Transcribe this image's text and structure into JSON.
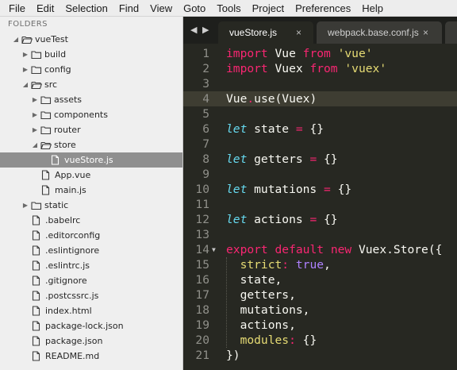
{
  "menu": [
    "File",
    "Edit",
    "Selection",
    "Find",
    "View",
    "Goto",
    "Tools",
    "Project",
    "Preferences",
    "Help"
  ],
  "sidebar": {
    "header": "FOLDERS",
    "tree": [
      {
        "label": "vueTest",
        "type": "folder",
        "open": true,
        "depth": 0
      },
      {
        "label": "build",
        "type": "folder",
        "open": false,
        "depth": 1
      },
      {
        "label": "config",
        "type": "folder",
        "open": false,
        "depth": 1
      },
      {
        "label": "src",
        "type": "folder",
        "open": true,
        "depth": 1
      },
      {
        "label": "assets",
        "type": "folder",
        "open": false,
        "depth": 2
      },
      {
        "label": "components",
        "type": "folder",
        "open": false,
        "depth": 2
      },
      {
        "label": "router",
        "type": "folder",
        "open": false,
        "depth": 2
      },
      {
        "label": "store",
        "type": "folder",
        "open": true,
        "depth": 2
      },
      {
        "label": "vueStore.js",
        "type": "file",
        "depth": 3,
        "selected": true
      },
      {
        "label": "App.vue",
        "type": "file",
        "depth": 2
      },
      {
        "label": "main.js",
        "type": "file",
        "depth": 2
      },
      {
        "label": "static",
        "type": "folder",
        "open": false,
        "depth": 1
      },
      {
        "label": ".babelrc",
        "type": "file",
        "depth": 1
      },
      {
        "label": ".editorconfig",
        "type": "file",
        "depth": 1
      },
      {
        "label": ".eslintignore",
        "type": "file",
        "depth": 1
      },
      {
        "label": ".eslintrc.js",
        "type": "file",
        "depth": 1
      },
      {
        "label": ".gitignore",
        "type": "file",
        "depth": 1
      },
      {
        "label": ".postcssrc.js",
        "type": "file",
        "depth": 1
      },
      {
        "label": "index.html",
        "type": "file",
        "depth": 1
      },
      {
        "label": "package-lock.json",
        "type": "file",
        "depth": 1
      },
      {
        "label": "package.json",
        "type": "file",
        "depth": 1
      },
      {
        "label": "README.md",
        "type": "file",
        "depth": 1
      }
    ]
  },
  "tabs": [
    {
      "label": "vueStore.js",
      "active": true,
      "close": "×"
    },
    {
      "label": "webpack.base.conf.js",
      "active": false,
      "close": "×"
    }
  ],
  "editor": {
    "current_line": 4,
    "folded_line": 14,
    "lines": [
      {
        "n": "1",
        "tokens": [
          [
            "keyword",
            "import"
          ],
          [
            "plain",
            " Vue "
          ],
          [
            "keyword",
            "from"
          ],
          [
            "plain",
            " "
          ],
          [
            "string",
            "'vue'"
          ]
        ]
      },
      {
        "n": "2",
        "tokens": [
          [
            "keyword",
            "import"
          ],
          [
            "plain",
            " Vuex "
          ],
          [
            "keyword",
            "from"
          ],
          [
            "plain",
            " "
          ],
          [
            "string",
            "'vuex'"
          ]
        ]
      },
      {
        "n": "3",
        "tokens": []
      },
      {
        "n": "4",
        "tokens": [
          [
            "plain",
            "Vue"
          ],
          [
            "op",
            "."
          ],
          [
            "plain",
            "use(Vuex)"
          ]
        ]
      },
      {
        "n": "5",
        "tokens": []
      },
      {
        "n": "6",
        "tokens": [
          [
            "storage",
            "let"
          ],
          [
            "plain",
            " state "
          ],
          [
            "op",
            "="
          ],
          [
            "plain",
            " {}"
          ]
        ]
      },
      {
        "n": "7",
        "tokens": []
      },
      {
        "n": "8",
        "tokens": [
          [
            "storage",
            "let"
          ],
          [
            "plain",
            " getters "
          ],
          [
            "op",
            "="
          ],
          [
            "plain",
            " {}"
          ]
        ]
      },
      {
        "n": "9",
        "tokens": []
      },
      {
        "n": "10",
        "tokens": [
          [
            "storage",
            "let"
          ],
          [
            "plain",
            " mutations "
          ],
          [
            "op",
            "="
          ],
          [
            "plain",
            " {}"
          ]
        ]
      },
      {
        "n": "11",
        "tokens": []
      },
      {
        "n": "12",
        "tokens": [
          [
            "storage",
            "let"
          ],
          [
            "plain",
            " actions "
          ],
          [
            "op",
            "="
          ],
          [
            "plain",
            " {}"
          ]
        ]
      },
      {
        "n": "13",
        "tokens": []
      },
      {
        "n": "14",
        "tokens": [
          [
            "keyword",
            "export"
          ],
          [
            "plain",
            " "
          ],
          [
            "keyword",
            "default"
          ],
          [
            "plain",
            " "
          ],
          [
            "keyword",
            "new"
          ],
          [
            "plain",
            " Vuex.Store({"
          ]
        ]
      },
      {
        "n": "15",
        "tokens": [
          [
            "plain",
            "  "
          ],
          [
            "prop",
            "strict"
          ],
          [
            "op",
            ":"
          ],
          [
            "plain",
            " "
          ],
          [
            "constant",
            "true"
          ],
          [
            "plain",
            ","
          ]
        ]
      },
      {
        "n": "16",
        "tokens": [
          [
            "plain",
            "  state,"
          ]
        ]
      },
      {
        "n": "17",
        "tokens": [
          [
            "plain",
            "  getters,"
          ]
        ]
      },
      {
        "n": "18",
        "tokens": [
          [
            "plain",
            "  mutations,"
          ]
        ]
      },
      {
        "n": "19",
        "tokens": [
          [
            "plain",
            "  actions,"
          ]
        ]
      },
      {
        "n": "20",
        "tokens": [
          [
            "plain",
            "  "
          ],
          [
            "prop",
            "modules"
          ],
          [
            "op",
            ":"
          ],
          [
            "plain",
            " {}"
          ]
        ]
      },
      {
        "n": "21",
        "tokens": [
          [
            "plain",
            "})"
          ]
        ]
      }
    ]
  },
  "icons": {
    "folder_closed": "folder-icon",
    "folder_open": "folder-open-icon",
    "file": "file-icon",
    "arrow_right": "▶",
    "arrow_down": "◢",
    "nav_left": "◀",
    "nav_right": "▶",
    "fold": "▼"
  },
  "colors": {
    "keyword": "#f92672",
    "storage": "#66d9ef",
    "string": "#e6db74",
    "constant": "#ae81ff",
    "editor_bg": "#272822",
    "gutter": "#90908a"
  }
}
